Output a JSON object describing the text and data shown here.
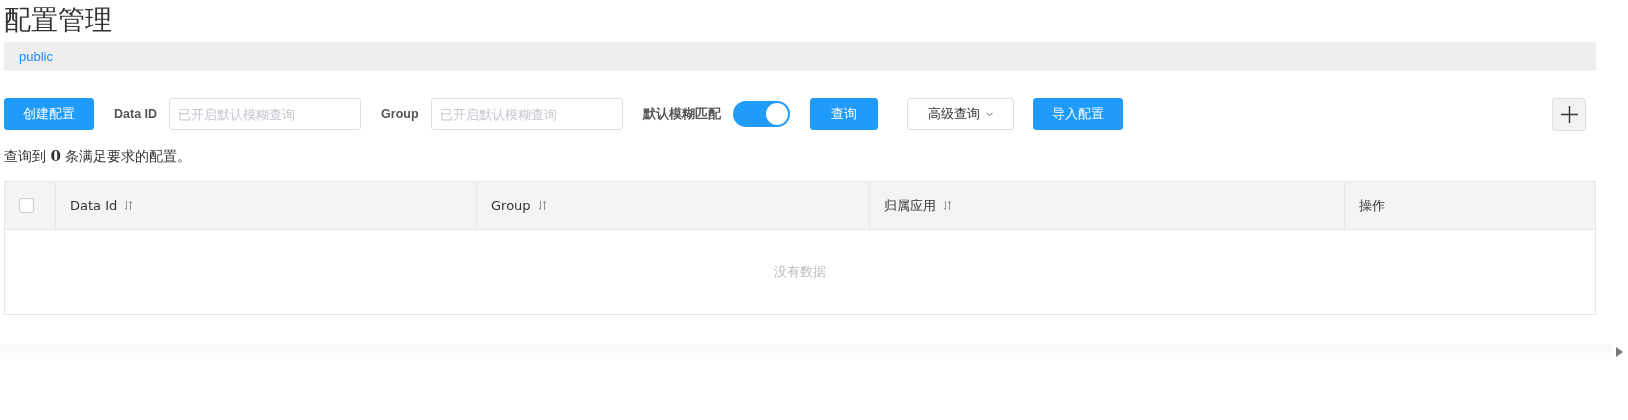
{
  "page_title": "配置管理",
  "namespace": {
    "label": "public"
  },
  "toolbar": {
    "create_button": "创建配置",
    "filters": [
      {
        "label": "Data ID",
        "placeholder": "已开启默认模糊查询"
      },
      {
        "label": "Group",
        "placeholder": "已开启默认模糊查询"
      }
    ],
    "fuzzy_match": {
      "label": "默认模糊匹配",
      "on": true
    },
    "search_button": "查询",
    "advanced_button": "高级查询",
    "import_button": "导入配置"
  },
  "result_summary": "查询到 **0** 条满足要求的配置。",
  "table": {
    "select_all": {
      "checked": false
    },
    "columns": [
      {
        "label": "Data Id",
        "sortable": true
      },
      {
        "label": "Group",
        "sortable": true
      },
      {
        "label": "归属应用",
        "sortable": true
      },
      {
        "label": "操作",
        "sortable": false
      }
    ],
    "empty_text": "没有数据"
  }
}
